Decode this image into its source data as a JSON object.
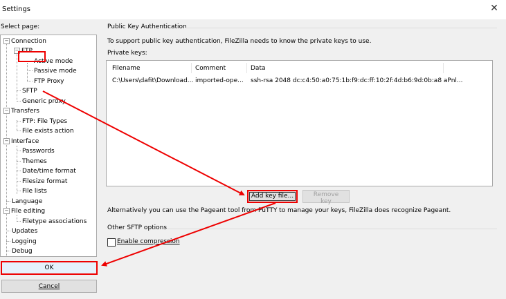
{
  "window": {
    "title": "Settings",
    "close_glyph": "✕"
  },
  "sidebar": {
    "label": "Select page:",
    "tree": [
      {
        "label": "Connection",
        "toggle": "−"
      },
      {
        "label": "FTP",
        "toggle": "−"
      },
      {
        "label": "Active mode"
      },
      {
        "label": "Passive mode"
      },
      {
        "label": "FTP Proxy"
      },
      {
        "label": "SFTP",
        "selected": true
      },
      {
        "label": "Generic proxy"
      },
      {
        "label": "Transfers",
        "toggle": "−"
      },
      {
        "label": "FTP: File Types"
      },
      {
        "label": "File exists action"
      },
      {
        "label": "Interface",
        "toggle": "−"
      },
      {
        "label": "Passwords"
      },
      {
        "label": "Themes"
      },
      {
        "label": "Date/time format"
      },
      {
        "label": "Filesize format"
      },
      {
        "label": "File lists"
      },
      {
        "label": "Language"
      },
      {
        "label": "File editing",
        "toggle": "−"
      },
      {
        "label": "Filetype associations"
      },
      {
        "label": "Updates"
      },
      {
        "label": "Logging"
      },
      {
        "label": "Debug"
      }
    ]
  },
  "buttons": {
    "ok": "OK",
    "cancel": "Cancel"
  },
  "main": {
    "section_title": "Public Key Authentication",
    "description": "To support public key authentication, FileZilla needs to know the private keys to use.",
    "private_keys_label": "Private keys:",
    "columns": [
      "Filename",
      "Comment",
      "Data"
    ],
    "rows": [
      {
        "filename": "C:\\Users\\dafit\\Download...",
        "comment": "imported-ope...",
        "data": "ssh-rsa 2048 dc:c4:50:a0:75:1b:f9:dc:ff:10:2f:4d:b6:9d:0b:a8 aPnl..."
      }
    ],
    "add_key_label": "Add key file...",
    "remove_key_label": "Remove key",
    "pageant_note": "Alternatively you can use the Pageant tool from PuTTY to manage your keys, FileZilla does recognize Pageant.",
    "other_title": "Other SFTP options",
    "enable_compression_label": "Enable compression",
    "enable_compression_checked": false
  },
  "annotation_color": "#e00000"
}
